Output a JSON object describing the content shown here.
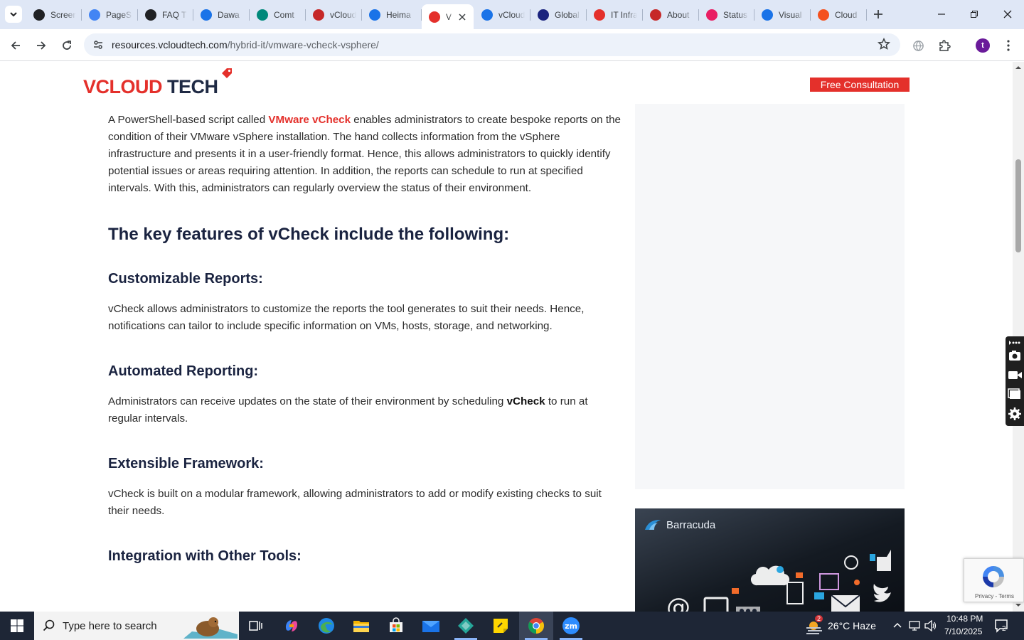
{
  "browser": {
    "tabs": [
      {
        "title": "Screen",
        "favicon": "screencast-icon",
        "color": "#202124"
      },
      {
        "title": "PageSpeed",
        "favicon": "pagespeed-icon",
        "color": "#4285f4"
      },
      {
        "title": "FAQ T",
        "favicon": "faq-icon",
        "color": "#202124"
      },
      {
        "title": "Dawa",
        "favicon": "dawa-icon",
        "color": "#1a73e8"
      },
      {
        "title": "Comt",
        "favicon": "comt-icon",
        "color": "#00897b"
      },
      {
        "title": "vCloud",
        "favicon": "vcloud-v-icon",
        "color": "#c62828"
      },
      {
        "title": "Heima",
        "favicon": "scale-icon",
        "color": "#1a73e8"
      },
      {
        "title": "V",
        "favicon": "vcloud-tag-icon",
        "color": "#e4302b",
        "active": true
      },
      {
        "title": "vCloud",
        "favicon": "check-icon",
        "color": "#1a73e8"
      },
      {
        "title": "Global",
        "favicon": "x-icon",
        "color": "#1a237e"
      },
      {
        "title": "IT Infra",
        "favicon": "vcloud-tag-icon",
        "color": "#e4302b"
      },
      {
        "title": "About",
        "favicon": "about-icon",
        "color": "#c62828"
      },
      {
        "title": "Status",
        "favicon": "status-icon",
        "color": "#e91e63"
      },
      {
        "title": "Visual",
        "favicon": "pulse-icon",
        "color": "#1a73e8"
      },
      {
        "title": "Cloud",
        "favicon": "cloud-slash-icon",
        "color": "#f4511e"
      }
    ],
    "url_host": "resources.vcloudtech.com",
    "url_path": "/hybrid-it/vmware-vcheck-vsphere/",
    "profile_initial": "t"
  },
  "page": {
    "logo": {
      "part1": "VCLOUD",
      "part2": " TECH"
    },
    "cta_label": "Free Consultation",
    "intro": {
      "before": "A PowerShell-based script called ",
      "highlight": "VMware vCheck",
      "after": " enables administrators to create bespoke reports on the condition of their VMware vSphere installation. The hand collects information from the vSphere infrastructure and presents it in a user-friendly format. Hence, this allows administrators to quickly identify potential issues or areas requiring attention. In addition, the reports can schedule to run at specified intervals. With this, administrators can regularly overview the status of their environment."
    },
    "features_heading": "The key features of vCheck include the following:",
    "sections": [
      {
        "heading": "Customizable Reports:",
        "body": "vCheck allows administrators to customize the reports the tool generates to suit their needs. Hence, notifications can tailor to include specific information on VMs, hosts, storage, and networking."
      },
      {
        "heading": "Automated Reporting:",
        "body_before": "Administrators can receive updates on the state of their environment by scheduling ",
        "body_bold": "vCheck",
        "body_after": " to run at regular intervals."
      },
      {
        "heading": "Extensible Framework:",
        "body": "vCheck is built on a modular framework, allowing administrators to add or modify existing checks to suit their needs."
      },
      {
        "heading": "Integration with Other Tools:"
      }
    ],
    "banner_brand": "Barracuda",
    "recaptcha_terms": "Privacy - Terms"
  },
  "taskbar": {
    "search_placeholder": "Type here to search",
    "weather": "26°C  Haze",
    "weather_badge": "2",
    "time": "10:48 PM",
    "date": "7/10/2025",
    "notification_count": "2"
  },
  "colors": {
    "accent_red": "#e4302b",
    "heading_navy": "#1a2340",
    "tabstrip": "#dfe7f6",
    "taskbar": "#1e2636"
  }
}
